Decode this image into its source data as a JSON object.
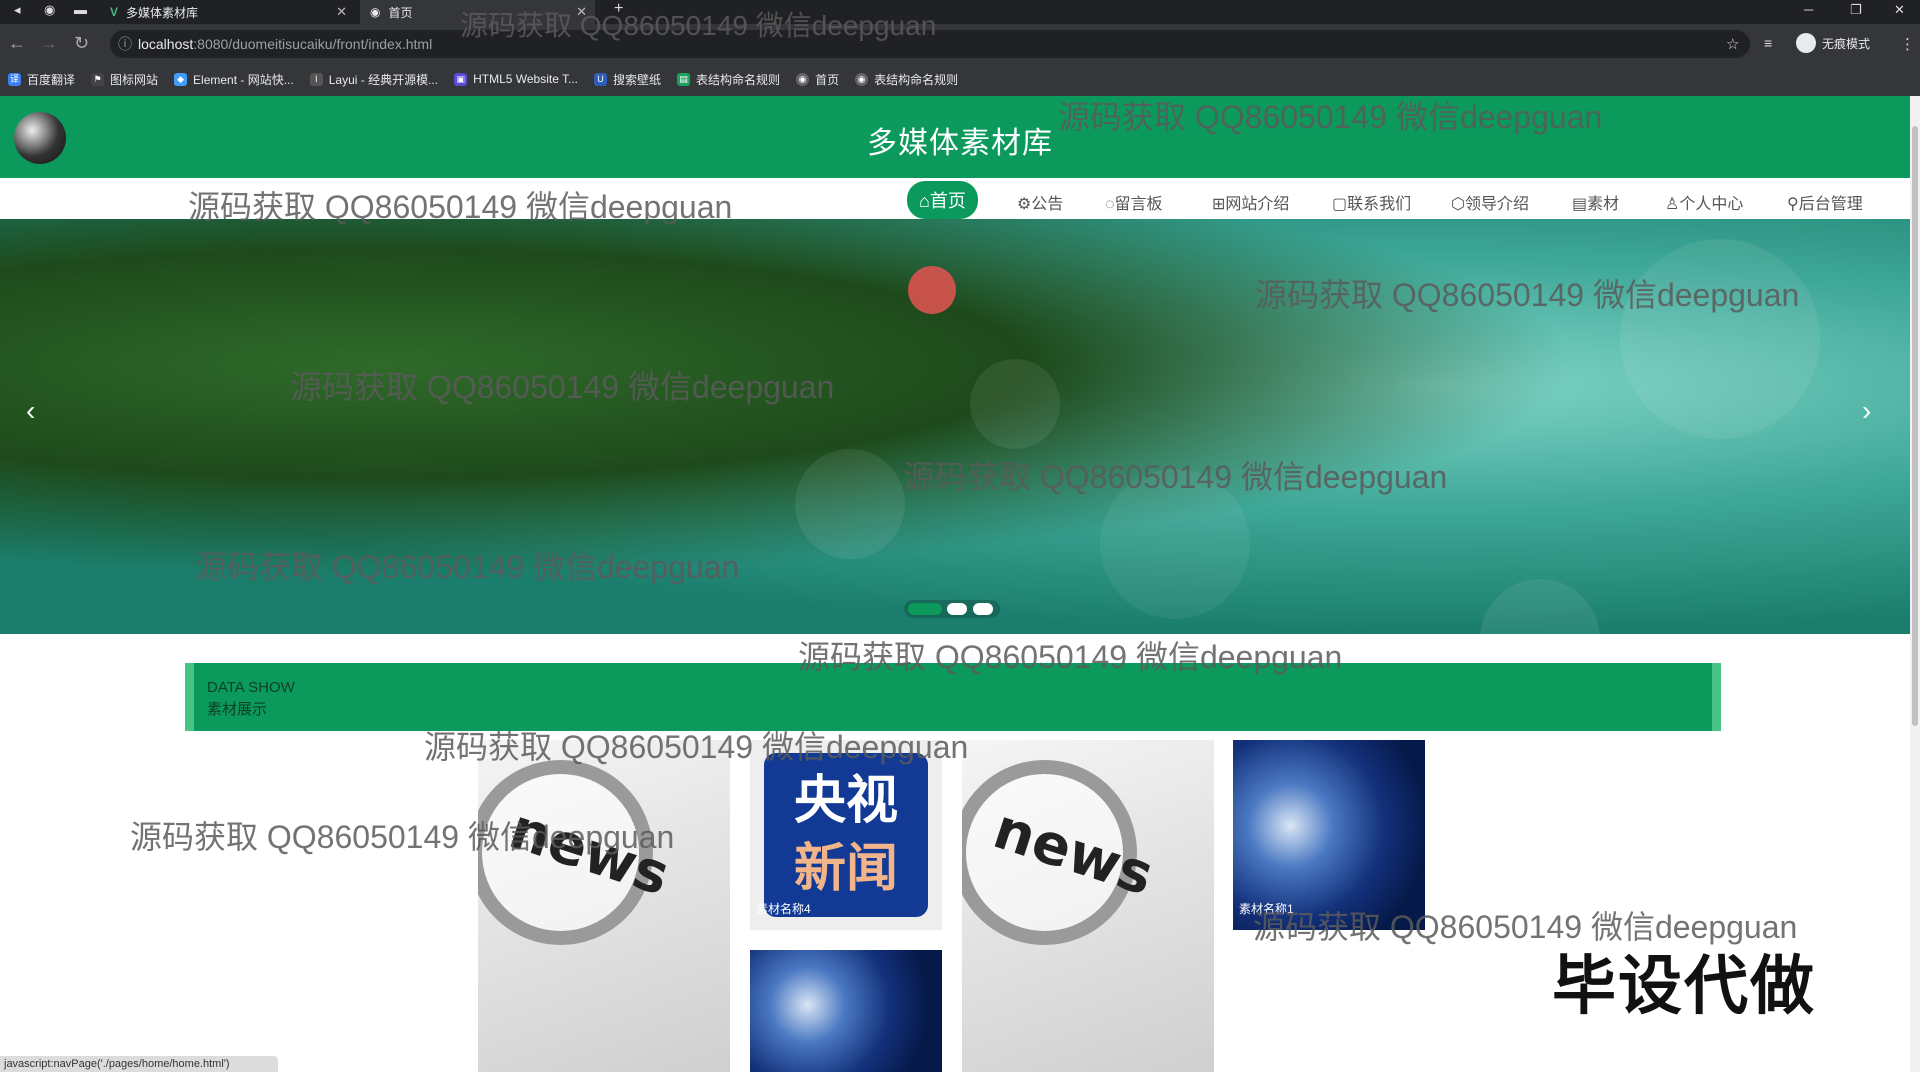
{
  "browser": {
    "tabs": [
      {
        "label": "多媒体素材库"
      },
      {
        "label": "首页"
      }
    ],
    "new_tab": "+",
    "url": {
      "host": "localhost",
      "rest": ":8080/duomeitisucaiku/front/index.html"
    },
    "profile": "无痕模式",
    "bookmarks": [
      "百度翻译",
      "图标网站",
      "Element - 网站快...",
      "Layui - 经典开源模...",
      "HTML5 Website T...",
      "搜索壁纸",
      "表结构命名规则",
      "首页",
      "表结构命名规则"
    ],
    "status": "javascript:navPage('./pages/home/home.html')"
  },
  "site": {
    "title": "多媒体素材库",
    "nav": [
      {
        "label": "⌂首页",
        "active": true
      },
      {
        "label": "公告"
      },
      {
        "label": "留言板"
      },
      {
        "label": "网站介绍"
      },
      {
        "label": "联系我们"
      },
      {
        "label": "领导介绍"
      },
      {
        "label": "素材"
      },
      {
        "label": "个人中心"
      },
      {
        "label": "后台管理"
      }
    ],
    "banner": {
      "prev": "‹",
      "next": "›"
    },
    "section": {
      "title_en": "DATA SHOW",
      "title_cn": "素材展示"
    },
    "cards": [
      {
        "image": "news"
      },
      {
        "image": "cctv-news",
        "caption": "素材名称4",
        "logo_line1": "央视",
        "logo_line2": "新闻"
      },
      {
        "image": "globe"
      },
      {
        "image": "news"
      },
      {
        "image": "globe",
        "caption": "素材名称1"
      }
    ],
    "news_word": "news"
  },
  "overlay": {
    "watermark": "源码获取 QQ86050149 微信deepguan",
    "promo": "毕设代做"
  },
  "colors": {
    "brand_green": "#0b9a5c",
    "accent": "#46c486"
  }
}
